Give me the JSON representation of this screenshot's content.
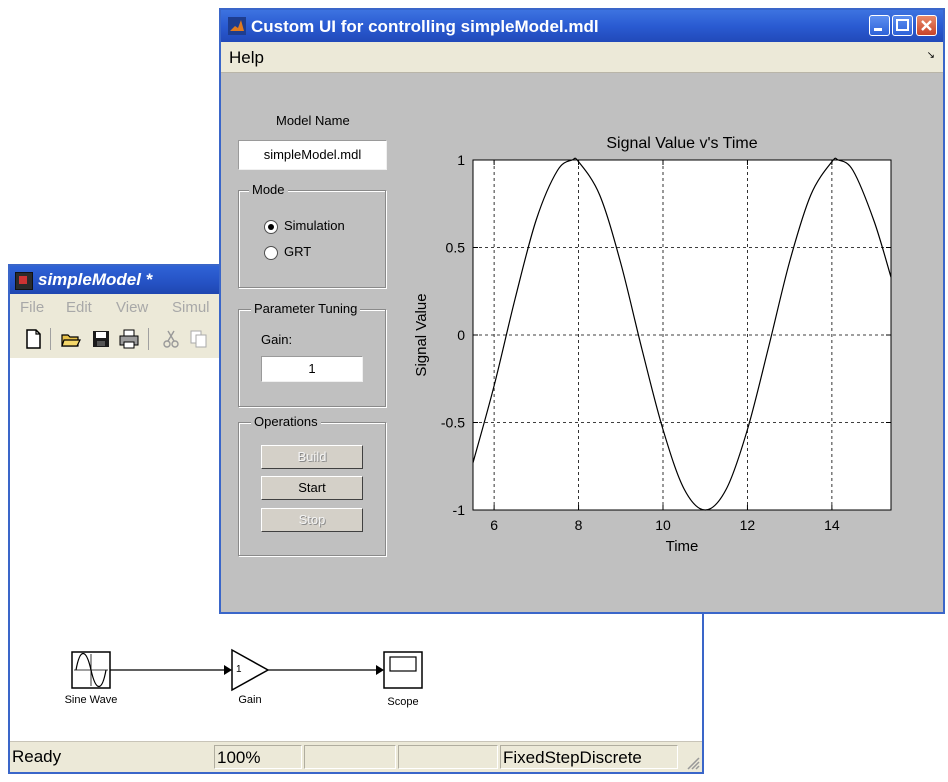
{
  "simple_model_window": {
    "title": "simpleModel *",
    "menu": [
      "File",
      "Edit",
      "View",
      "Simul"
    ],
    "toolbar_icons": [
      "new-icon",
      "open-icon",
      "save-icon",
      "print-icon",
      "cut-icon",
      "copy-icon"
    ],
    "blocks": {
      "sine_wave": "Sine Wave",
      "gain": "Gain",
      "gain_value": "1",
      "scope": "Scope"
    },
    "status": {
      "state": "Ready",
      "zoom": "100%",
      "solver": "FixedStepDiscrete"
    }
  },
  "custom_ui_window": {
    "title": "Custom UI for controlling simpleModel.mdl",
    "menu": {
      "help": "Help",
      "arrow": "↘"
    },
    "model_name_label": "Model Name",
    "model_name_value": "simpleModel.mdl",
    "mode_group": {
      "title": "Mode",
      "options": [
        "Simulation",
        "GRT"
      ],
      "selected": "Simulation"
    },
    "parameter_group": {
      "title": "Parameter Tuning",
      "gain_label": "Gain:",
      "gain_value": "1"
    },
    "operations_group": {
      "title": "Operations",
      "build": "Build",
      "start": "Start",
      "stop": "Stop",
      "build_enabled": false,
      "start_enabled": true,
      "stop_enabled": false
    }
  },
  "chart_data": {
    "type": "line",
    "title": "Signal Value v's Time",
    "xlabel": "Time",
    "ylabel": "Signal Value",
    "xlim": [
      5.5,
      15.4
    ],
    "ylim": [
      -1,
      1
    ],
    "xticks": [
      6,
      8,
      10,
      12,
      14
    ],
    "yticks": [
      1,
      0.5,
      0,
      -0.5,
      -1
    ],
    "ytick_labels": [
      "1",
      "0.5",
      "0",
      "-0.5",
      "-1"
    ],
    "grid": true,
    "series": [
      {
        "x": [
          5.5,
          6.0,
          6.5,
          7.0,
          7.5,
          7.85,
          8.0,
          8.5,
          9.0,
          9.5,
          10.0,
          10.5,
          11.0,
          11.5,
          12.0,
          12.5,
          13.0,
          13.5,
          14.0,
          14.15,
          14.5,
          15.0,
          15.4
        ],
        "y": [
          -0.73,
          -0.29,
          0.21,
          0.66,
          0.94,
          1.0,
          0.99,
          0.8,
          0.41,
          -0.08,
          -0.54,
          -0.88,
          -1.0,
          -0.88,
          -0.54,
          -0.07,
          0.42,
          0.8,
          0.99,
          1.0,
          0.94,
          0.65,
          0.33
        ],
        "color": "#000000"
      }
    ]
  }
}
